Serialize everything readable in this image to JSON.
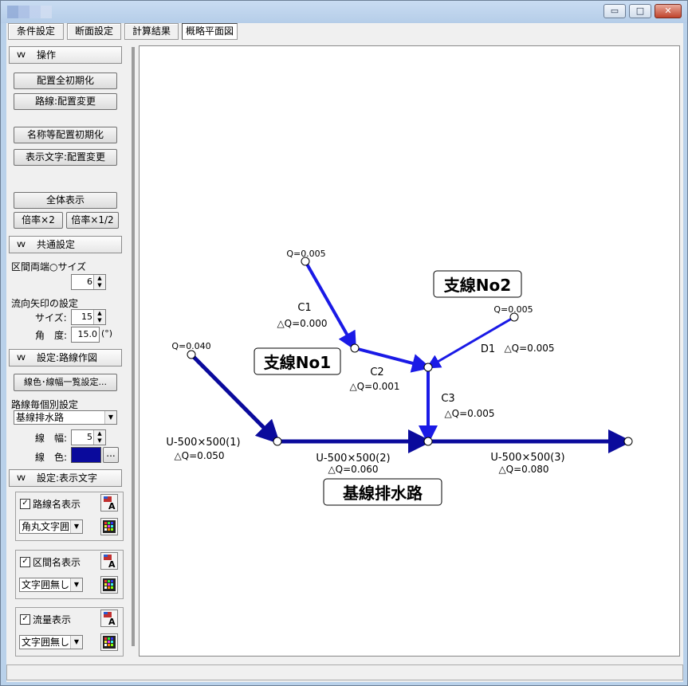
{
  "tabs": [
    "条件設定",
    "断面設定",
    "計算結果",
    "概略平面図"
  ],
  "active_tab": 3,
  "window_buttons": {
    "minimize": "▭",
    "maximize": "□",
    "close": "✕"
  },
  "panel": {
    "section_ops": "操作",
    "btn_reset_all": "配置全初期化",
    "btn_route_move": "路線:配置変更",
    "btn_name_reset": "名称等配置初期化",
    "btn_text_move": "表示文字:配置変更",
    "btn_fit": "全体表示",
    "btn_zoom_in": "倍率×2",
    "btn_zoom_out": "倍率×1/2",
    "section_common": "共通設定",
    "label_node_size": "区間両端○サイズ",
    "node_size": "6",
    "label_arrow": "流向矢印の設定",
    "label_arrow_size": "サイズ:",
    "arrow_size": "15",
    "label_angle": "角　度:",
    "angle": "15.0",
    "angle_unit": "(°)",
    "section_route": "設定:路線作図",
    "btn_color_list": "線色･線幅一覧設定...",
    "label_per_route": "路線毎個別設定",
    "route_select": "基線排水路",
    "label_width": "線　幅:",
    "line_width": "5",
    "label_color": "線　色:",
    "line_color": "#0a0a9c",
    "color_more": "...",
    "section_text": "設定:表示文字",
    "opt_route_name": "路線名表示",
    "opt_route_frame": "角丸文字囲",
    "opt_section_name": "区間名表示",
    "opt_section_frame": "文字囲無し",
    "opt_flow": "流量表示",
    "opt_flow_frame": "文字囲無し",
    "check_mark": "✓"
  },
  "diagram": {
    "route_names": [
      "支線No1",
      "支線No2",
      "基線排水路"
    ],
    "flows": [
      "Q=0.005",
      "Q=0.005",
      "Q=0.040"
    ],
    "section_names": [
      "C1",
      "C2",
      "C3",
      "D1",
      "U-500×500(1)",
      "U-500×500(2)",
      "U-500×500(3)"
    ],
    "dq": [
      "△Q=0.000",
      "△Q=0.001",
      "△Q=0.005",
      "△Q=0.005",
      "△Q=0.050",
      "△Q=0.060",
      "△Q=0.080"
    ],
    "line_color_main": "#0a0a9c",
    "line_color_branch": "#1a1ae6"
  }
}
